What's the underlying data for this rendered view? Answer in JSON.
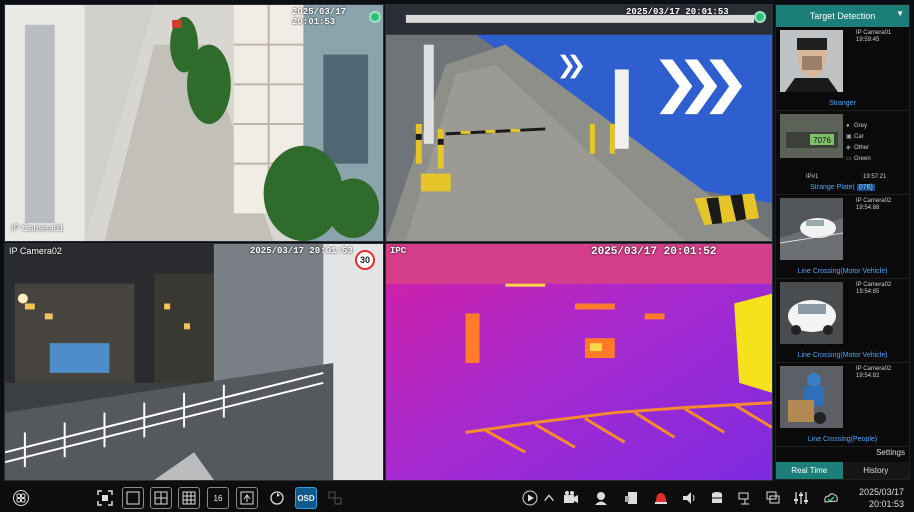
{
  "cameras": {
    "tl": {
      "timestamp": "2025/03/17 20:01:53",
      "name": "IP Camera01"
    },
    "tr": {
      "timestamp": "2025/03/17 20:01:53",
      "name": ""
    },
    "bl": {
      "timestamp": "2025/03/17 20:01:53",
      "name": "IP Camera02",
      "sign": "30"
    },
    "br": {
      "timestamp": "2025/03/17 20:01:52",
      "name": "IPC"
    }
  },
  "panel": {
    "title": "Target Detection",
    "events": [
      {
        "source": "IP Camera01",
        "time": "19:59:45",
        "label": "Stranger"
      },
      {
        "source": "IP#1",
        "time": "19:57:21",
        "label": "Strange Plate(",
        "plate_suffix": "076)",
        "plate_number": "7076",
        "attributes": [
          "Grey",
          "Car",
          "Other",
          "Green"
        ]
      },
      {
        "source": "IP Camera02",
        "time": "19:54:88",
        "label": "Line Crossing(Motor Vehicle)"
      },
      {
        "source": "IP Camera02",
        "time": "19:54:85",
        "label": "Line Crossing(Motor Vehicle)"
      },
      {
        "source": "IP Camera02",
        "time": "19:54:82",
        "label": "Line Crossing(People)"
      }
    ],
    "settings_label": "Settings",
    "tabs": [
      "Real Time",
      "History"
    ]
  },
  "toolbar": {
    "split_16_label": "16",
    "osd_label": "OSD",
    "date": "2025/03/17",
    "time": "20:01:53"
  },
  "colors": {
    "accent": "#1b7e78",
    "event_label": "#4aa6ff",
    "recording": "#2fbf75"
  }
}
